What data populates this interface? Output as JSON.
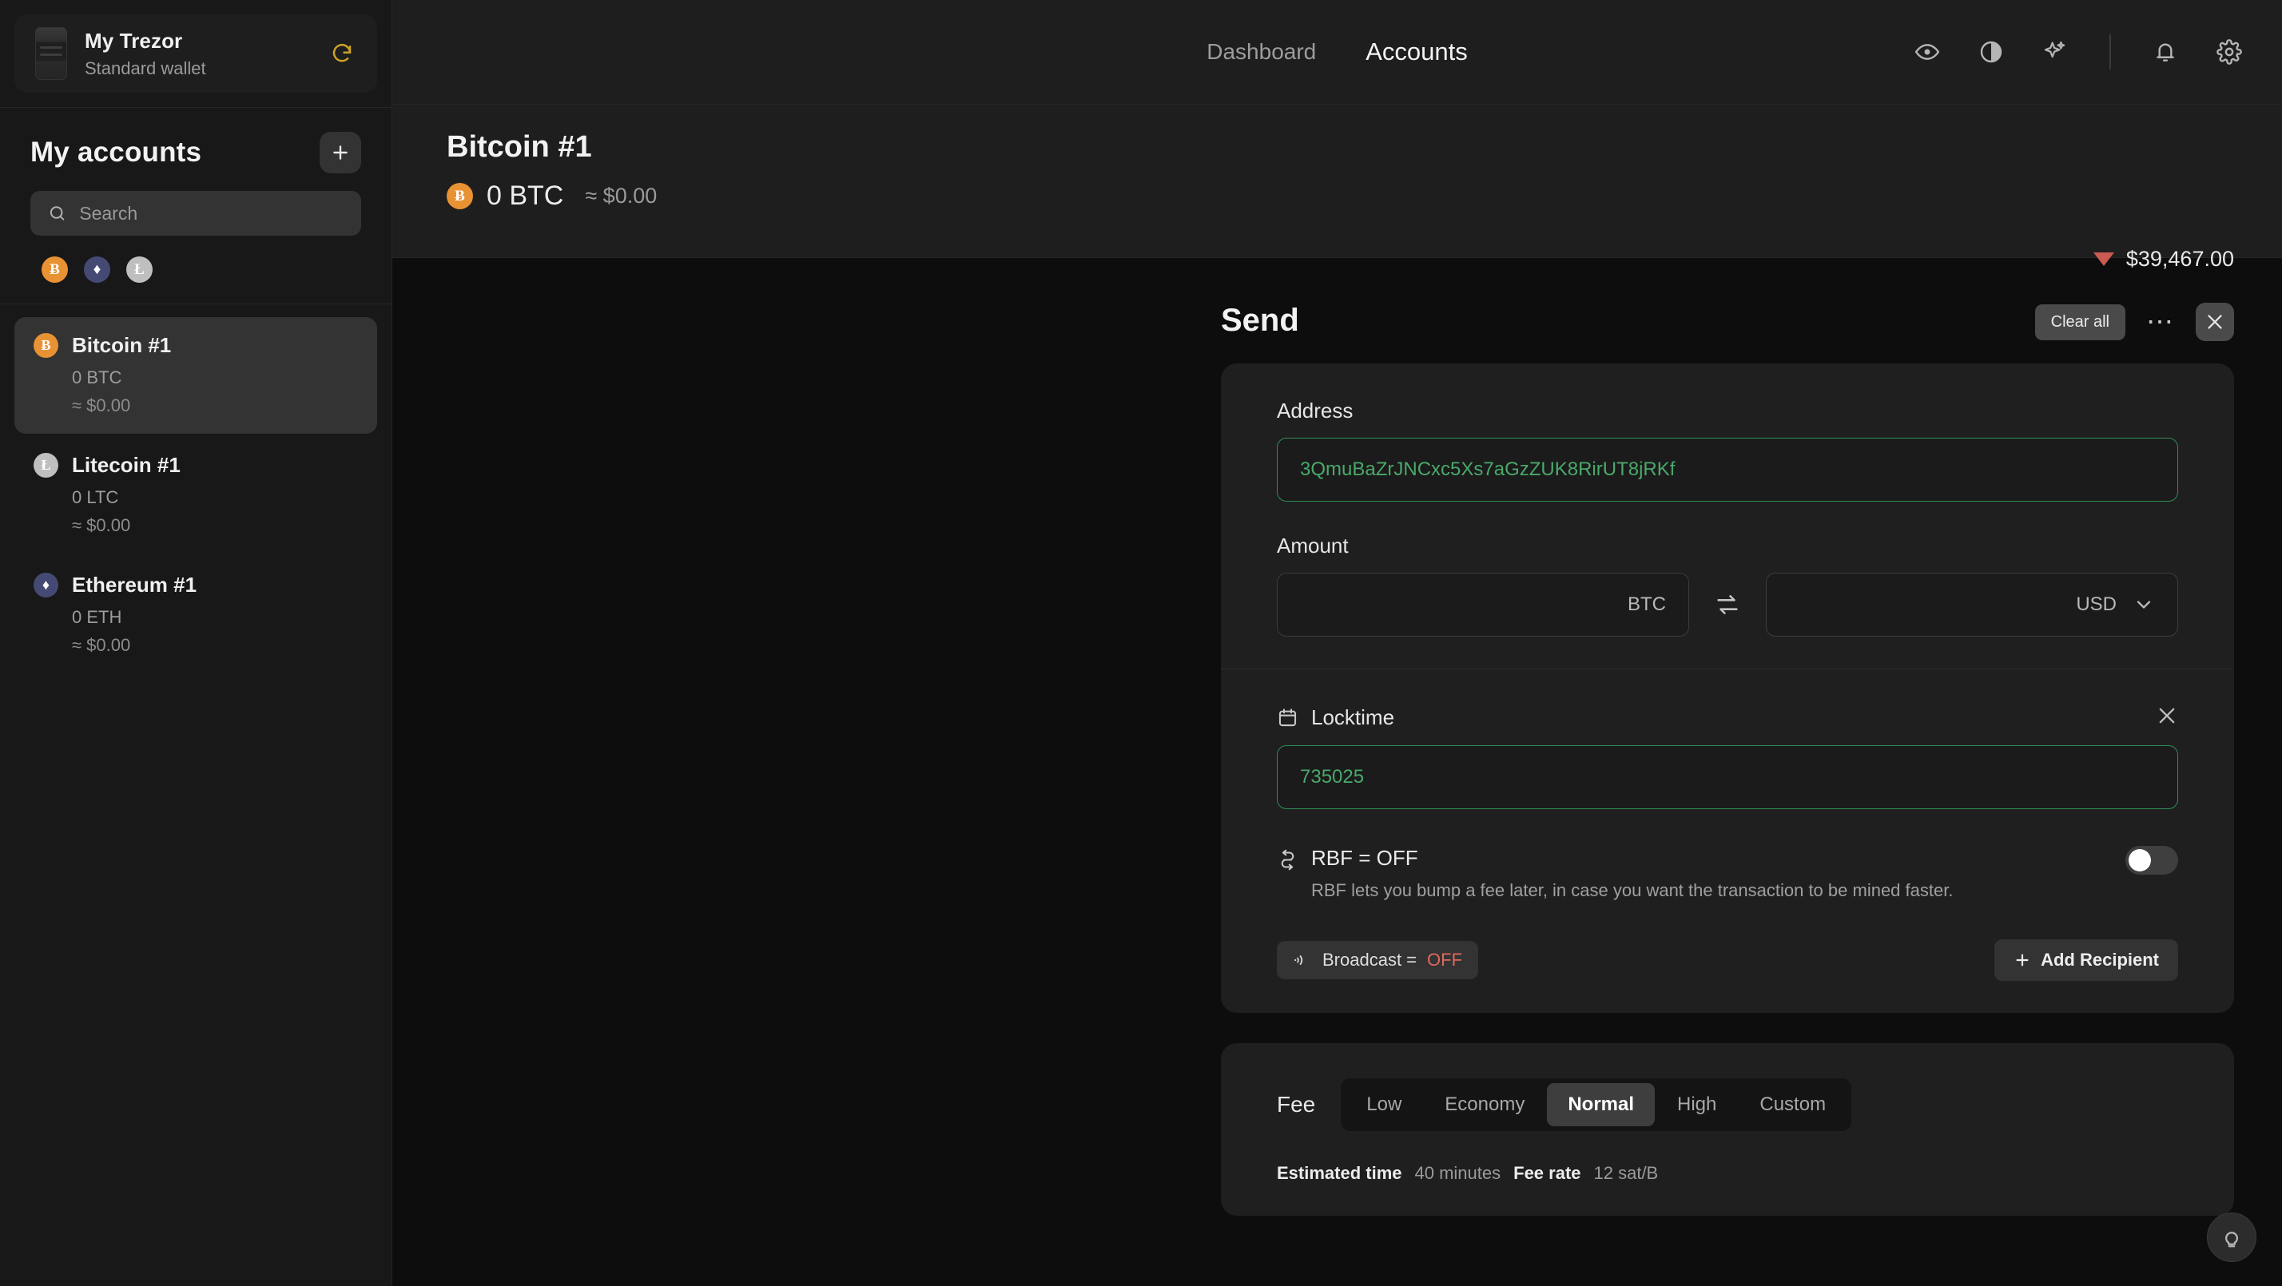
{
  "sidebar": {
    "device": {
      "name": "My Trezor",
      "subtitle": "Standard wallet",
      "refresh_icon": "refresh-icon",
      "device_image": "trezor-device-image"
    },
    "accounts_title": "My accounts",
    "add_account_label": "+",
    "search": {
      "placeholder": "Search",
      "value": ""
    },
    "coin_filters": [
      {
        "symbol": "Ƀ",
        "name": "bitcoin",
        "color": "#e89233"
      },
      {
        "symbol": "♦",
        "name": "ethereum",
        "color": "#454a75"
      },
      {
        "symbol": "Ł",
        "name": "litecoin",
        "color": "#bfbfbf"
      }
    ],
    "accounts": [
      {
        "name": "Bitcoin #1",
        "amount": "0 BTC",
        "fiat": "≈ $0.00",
        "symbol": "Ƀ",
        "color": "#e89233",
        "selected": true
      },
      {
        "name": "Litecoin #1",
        "amount": "0 LTC",
        "fiat": "≈ $0.00",
        "symbol": "Ł",
        "color": "#bfbfbf",
        "selected": false
      },
      {
        "name": "Ethereum #1",
        "amount": "0 ETH",
        "fiat": "≈ $0.00",
        "symbol": "♦",
        "color": "#454a75",
        "selected": false
      }
    ]
  },
  "topbar": {
    "tabs": [
      {
        "label": "Dashboard",
        "active": false
      },
      {
        "label": "Accounts",
        "active": true
      }
    ],
    "icons": [
      "eye-icon",
      "contrast-icon",
      "sparkle-icon",
      "bell-icon",
      "gear-icon"
    ]
  },
  "account_header": {
    "title": "Bitcoin #1",
    "balance": "0 BTC",
    "balance_fiat": "≈ $0.00",
    "coin_symbol": "Ƀ",
    "ticker_value": "$39,467.00",
    "ticker_direction": "down",
    "ticker_color": "#cb5a52"
  },
  "send": {
    "title": "Send",
    "clear_all_label": "Clear all",
    "more_label": "⋯",
    "close_label": "✕",
    "address": {
      "label": "Address",
      "value": "3QmuBaZrJNCxc5Xs7aGzZUK8RirUT8jRKf",
      "valid_color": "#4aa96b"
    },
    "amount": {
      "label": "Amount",
      "crypto_value": "",
      "crypto_unit": "BTC",
      "fiat_value": "",
      "fiat_unit": "USD",
      "swap_icon": "swap-icon",
      "chevron": "chevron-down-icon"
    },
    "locktime": {
      "label": "Locktime",
      "icon": "calendar-icon",
      "value": "735025",
      "remove_label": "✕"
    },
    "rbf": {
      "icon": "rbf-icon",
      "title": "RBF = OFF",
      "description": "RBF lets you bump a fee later, in case you want the transaction to be mined faster.",
      "enabled": false
    },
    "broadcast": {
      "icon": "broadcast-icon",
      "label": "Broadcast = ",
      "state": "OFF",
      "state_color": "#e0695f"
    },
    "add_recipient_label": "Add Recipient"
  },
  "fee": {
    "label": "Fee",
    "options": [
      {
        "label": "Low",
        "active": false
      },
      {
        "label": "Economy",
        "active": false
      },
      {
        "label": "Normal",
        "active": true
      },
      {
        "label": "High",
        "active": false
      },
      {
        "label": "Custom",
        "active": false
      }
    ],
    "estimated_time_label": "Estimated time",
    "estimated_time_value": "40 minutes",
    "fee_rate_label": "Fee rate",
    "fee_rate_value": "12 sat/B"
  },
  "help": {
    "icon": "lightbulb-icon"
  }
}
